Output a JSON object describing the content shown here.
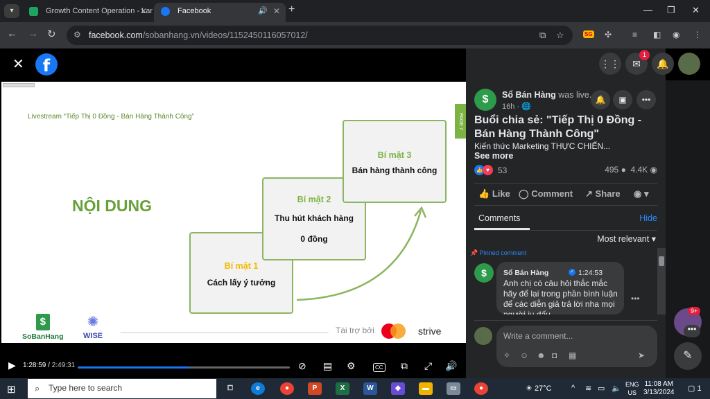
{
  "browser": {
    "tabs": [
      {
        "title": "Growth Content Operation - Lar",
        "favicon_color": "#1ea362"
      },
      {
        "title": "Facebook",
        "favicon_color": "#1877f2",
        "active": true
      }
    ],
    "url_host": "facebook.com",
    "url_path": "/sobanhang.vn/videos/1152450116057012/"
  },
  "slide": {
    "subtitle": "Livestream “Tiếp Thị 0 Đồng - Bán Hàng Thành Công”",
    "page_tag": "PAGE 7",
    "heading": "NỘI DUNG",
    "boxes": [
      {
        "title": "Bí mật 1",
        "line1": "Cách lấy ý tưởng",
        "line2": ""
      },
      {
        "title": "Bí mật 2",
        "line1": "Thu hút khách hàng",
        "line2": "0 đồng"
      },
      {
        "title": "Bí mật 3",
        "line1": "Bán hàng thành công",
        "line2": ""
      }
    ],
    "logo_sobanhang": "SoBanHang",
    "logo_wise": "WISE",
    "sponsor_label": "Tài trợ bởi",
    "sponsor_strive": "strive"
  },
  "player": {
    "current_time": "1:28:59",
    "duration": "2:49:31",
    "progress_fraction": 0.525
  },
  "panel": {
    "messenger_badge": "1",
    "page_name": "Sổ Bán Hàng",
    "was_live": "was live.",
    "post_time": "16h",
    "title": "Buổi chia sẻ: \"Tiếp Thị 0 Đồng - Bán Hàng Thành Công\"",
    "description": "Kiến thức Marketing THỰC CHIẾN...",
    "see_more": "See more",
    "reactions_count": "53",
    "comments_count": "495",
    "views_count": "4.4K",
    "like_label": "Like",
    "comment_label": "Comment",
    "share_label": "Share",
    "comments_tab": "Comments",
    "hide_label": "Hide",
    "sort_label": "Most relevant",
    "pinned_label": "Pinned comment",
    "comment": {
      "author": "Sổ Bán Hàng",
      "time": "1:24:53",
      "text": "Anh chị có câu hỏi thắc mắc hãy để lại trong phần bình luận để các diễn giả trả lời nha mọi người iu dấu"
    },
    "compose_placeholder": "Write a comment...",
    "chat_badge": "9+"
  },
  "taskbar": {
    "search_placeholder": "Type here to search",
    "weather": "27°C",
    "lang": "ENG",
    "region": "US",
    "time": "11:08 AM",
    "date": "3/13/2024",
    "notif_count": "1"
  }
}
